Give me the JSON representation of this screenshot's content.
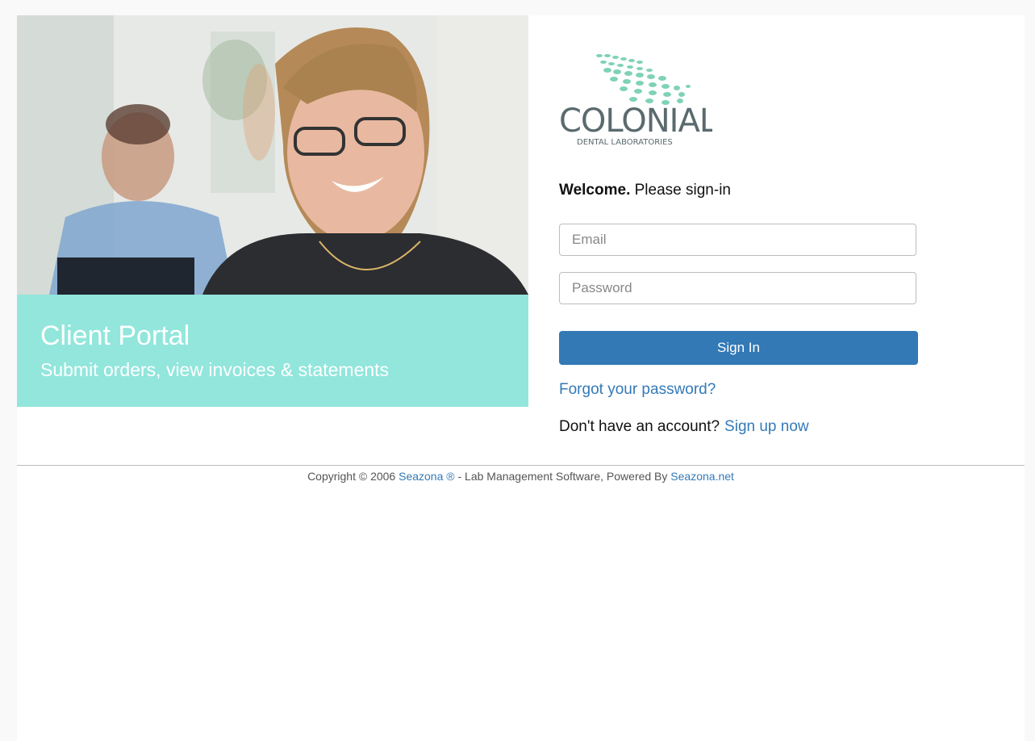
{
  "hero": {
    "title": "Client Portal",
    "subtitle": "Submit orders, view invoices & statements",
    "banner_color": "#92e6dc"
  },
  "logo": {
    "name": "COLONIAL",
    "tagline": "DENTAL LABORATORIES",
    "color_primary": "#6fcfb4",
    "color_text": "#5a6a6e"
  },
  "login": {
    "welcome_bold": "Welcome.",
    "welcome_rest": " Please sign-in",
    "email_placeholder": "Email",
    "password_placeholder": "Password",
    "signin_label": "Sign In",
    "forgot_label": "Forgot your password?",
    "no_account_text": "Don't have an account?",
    "signup_label": "Sign up now",
    "accent_color": "#3279b6"
  },
  "footer": {
    "copyright_prefix": "Copyright © 2006 ",
    "seazona_link": "Seazona ®",
    "middle_text": " - Lab Management Software, Powered By ",
    "seazona_net_link": "Seazona.net"
  }
}
